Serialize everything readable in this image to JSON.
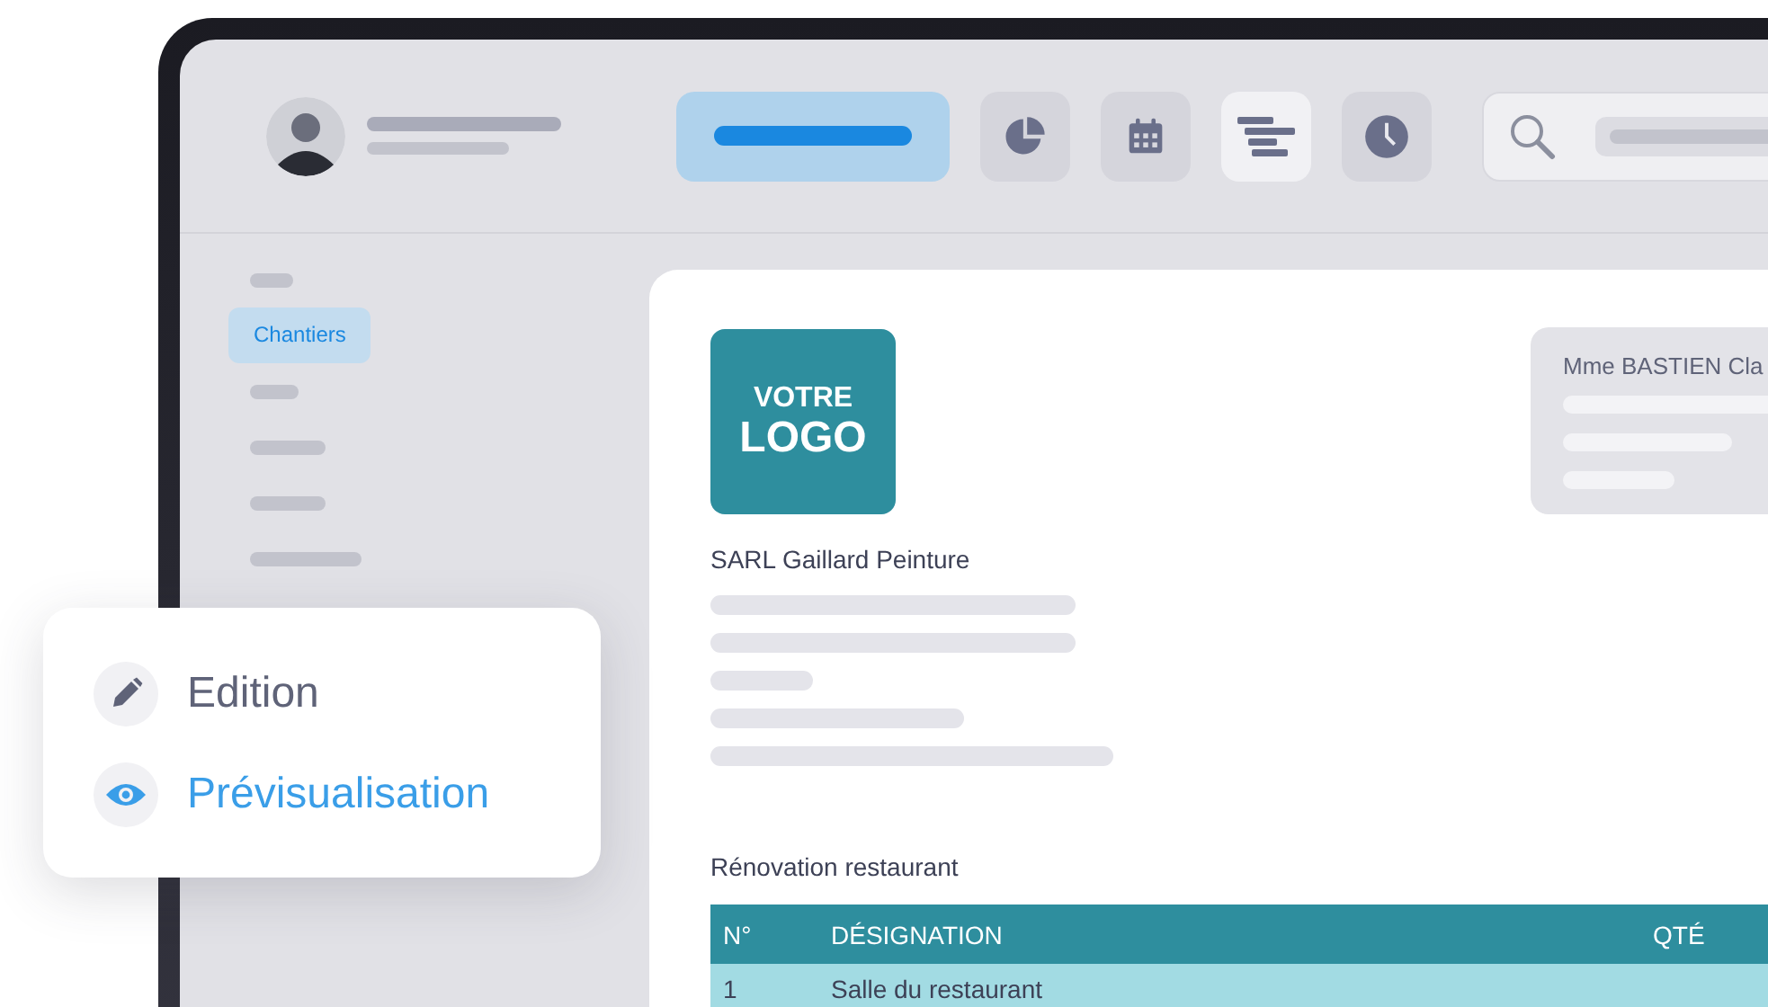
{
  "toolbar": [
    {
      "kind": "wide",
      "selected": true,
      "hovered": false
    },
    {
      "kind": "pie",
      "selected": false,
      "hovered": false
    },
    {
      "kind": "calendar",
      "selected": false,
      "hovered": false
    },
    {
      "kind": "gantt",
      "selected": false,
      "hovered": true
    },
    {
      "kind": "clock",
      "selected": false,
      "hovered": false
    }
  ],
  "sidebar": {
    "items": [
      {
        "kind": "bar",
        "selected": false
      },
      {
        "kind": "label",
        "label": "Chantiers",
        "selected": true
      },
      {
        "kind": "bar",
        "selected": false
      },
      {
        "kind": "bar",
        "selected": false
      },
      {
        "kind": "bar",
        "selected": false
      },
      {
        "kind": "bar",
        "selected": false
      }
    ]
  },
  "document": {
    "logo": [
      "VOTRE",
      "LOGO"
    ],
    "client": "Mme BASTIEN Cla",
    "company": "SARL Gaillard Peinture",
    "section_title": "Rénovation restaurant",
    "table": {
      "columns": [
        "N°",
        "DÉSIGNATION",
        "QTÉ"
      ],
      "rows": [
        [
          "1",
          "Salle du restaurant"
        ]
      ]
    }
  },
  "mode_menu": {
    "items": [
      {
        "kind": "edit",
        "label": "Edition",
        "selected": false
      },
      {
        "kind": "preview",
        "label": "Prévisualisation",
        "selected": true
      }
    ]
  }
}
